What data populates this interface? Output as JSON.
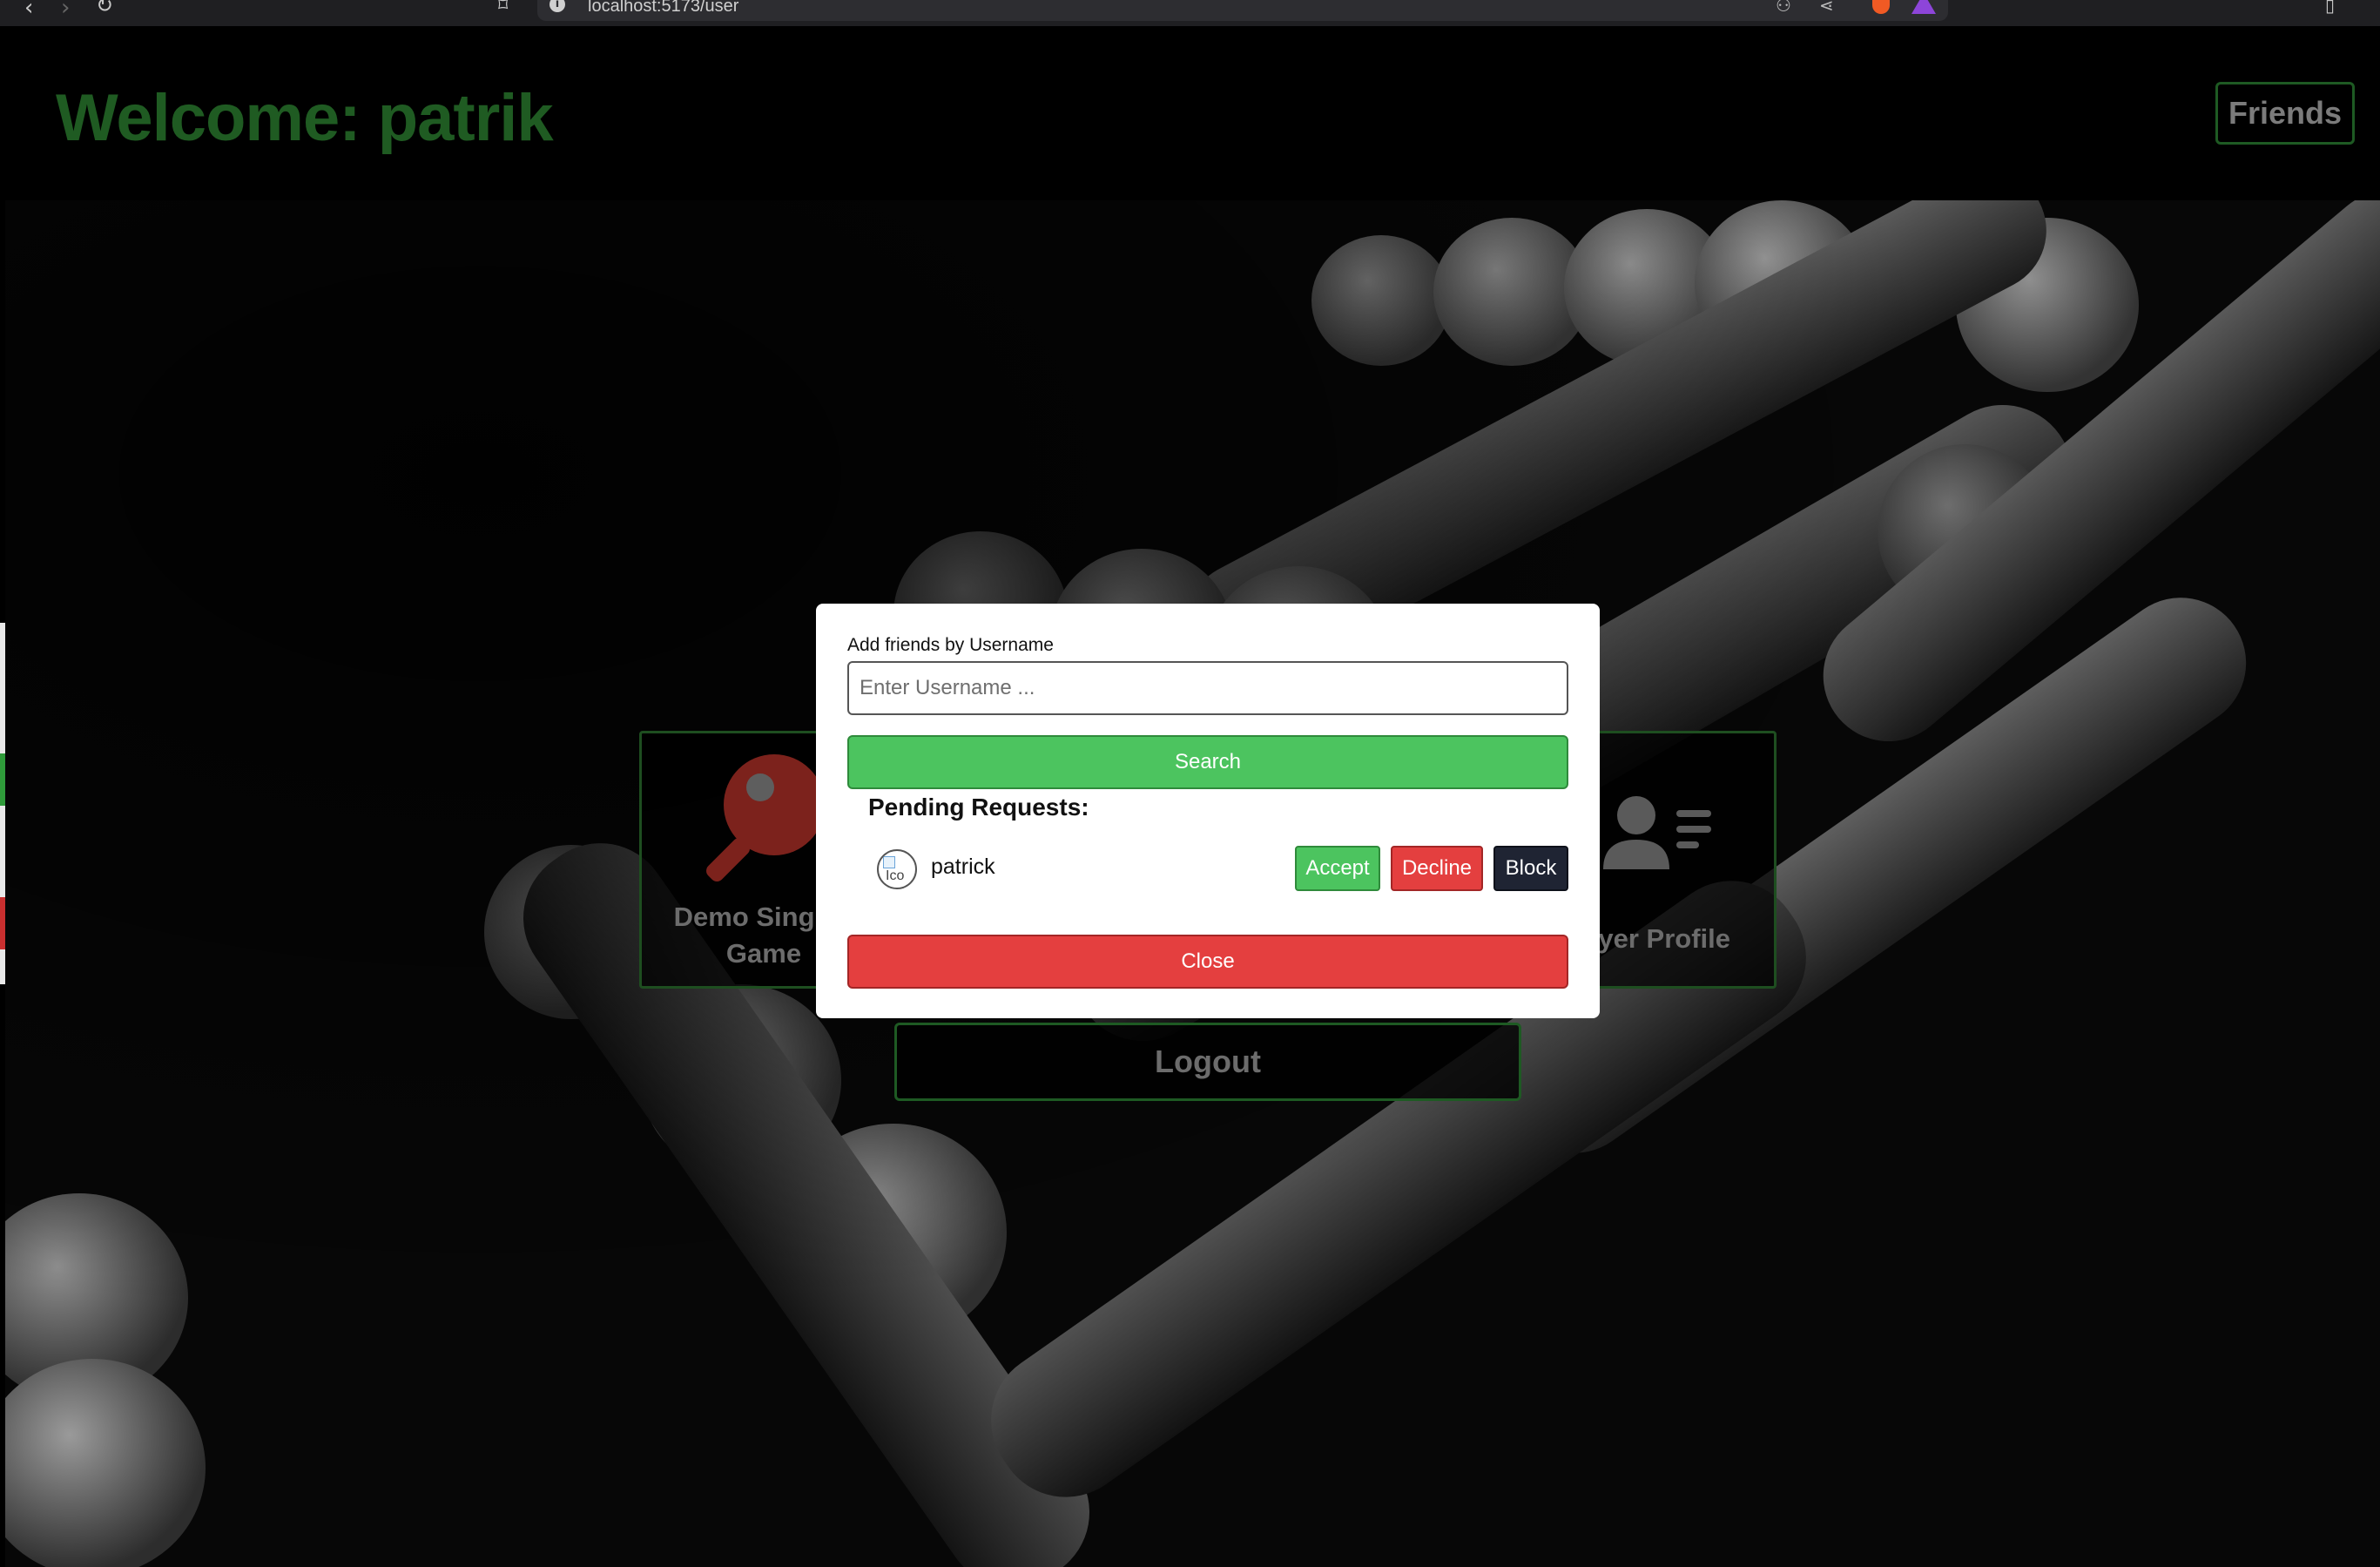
{
  "browser": {
    "url": "localhost:5173/user"
  },
  "header": {
    "welcome": "Welcome: patrik",
    "friends_label": "Friends"
  },
  "cards": {
    "left_label": "Demo Singlep\nGame",
    "right_label": "yer Profile"
  },
  "logout_label": "Logout",
  "modal": {
    "label": "Add friends by Username",
    "input_placeholder": "Enter Username ...",
    "input_value": "",
    "search_label": "Search",
    "pending_title": "Pending Requests:",
    "requests": [
      {
        "username": "patrick",
        "avatar_alt": "Ico",
        "accept_label": "Accept",
        "decline_label": "Decline",
        "block_label": "Block"
      }
    ],
    "close_label": "Close"
  },
  "colors": {
    "brand_green": "#1f5b22",
    "search_green": "#4cc45f",
    "close_red": "#e43f3f",
    "block_dark": "#1f2433"
  },
  "icons": {
    "paddle": "ping-pong-paddle-icon",
    "profile": "user-list-icon"
  }
}
